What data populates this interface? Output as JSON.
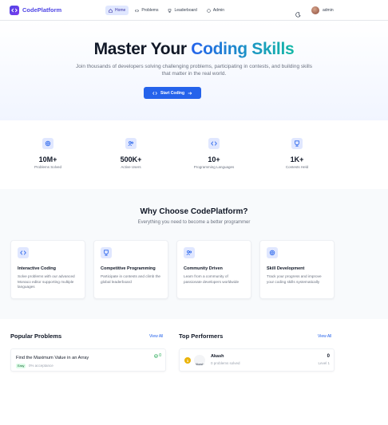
{
  "nav": {
    "brand": "CodePlatform",
    "links": [
      {
        "label": "Home",
        "icon": "home-icon",
        "active": true
      },
      {
        "label": "Problems",
        "icon": "code-icon",
        "active": false
      },
      {
        "label": "Leaderboard",
        "icon": "trophy-icon",
        "active": false
      },
      {
        "label": "Admin",
        "icon": "shield-icon",
        "active": false
      }
    ],
    "user_name": "admin"
  },
  "hero": {
    "title_plain": "Master Your ",
    "title_highlight": "Coding Skills",
    "subtitle": "Join thousands of developers solving challenging problems, participating in contests, and building skills that matter in the real world.",
    "cta_label": "Start Coding"
  },
  "stats": [
    {
      "value": "10M+",
      "label": "Problems Solved",
      "icon": "target-icon"
    },
    {
      "value": "500K+",
      "label": "Active Users",
      "icon": "users-icon"
    },
    {
      "value": "10+",
      "label": "Programming Languages",
      "icon": "code-icon"
    },
    {
      "value": "1K+",
      "label": "Contests Held",
      "icon": "trophy-icon"
    }
  ],
  "why": {
    "title": "Why Choose CodePlatform?",
    "subtitle": "Everything you need to become a better programmer",
    "features": [
      {
        "title": "Interactive Coding",
        "desc": "Solve problems with our advanced Monaco editor supporting multiple languages",
        "icon": "code-icon"
      },
      {
        "title": "Competitive Programming",
        "desc": "Participate in contests and climb the global leaderboard",
        "icon": "trophy-icon"
      },
      {
        "title": "Community Driven",
        "desc": "Learn from a community of passionate developers worldwide",
        "icon": "users-icon"
      },
      {
        "title": "Skill Development",
        "desc": "Track your progress and improve your coding skills systematically",
        "icon": "target-icon"
      }
    ]
  },
  "popular": {
    "title": "Popular Problems",
    "view_all": "View All",
    "items": [
      {
        "title": "Find the Maximum Value in an Array",
        "difficulty": "Easy",
        "acceptance": "0% acceptance",
        "count": "0"
      }
    ]
  },
  "performers": {
    "title": "Top Performers",
    "view_all": "View All",
    "items": [
      {
        "rank": "1",
        "avatar_alt": "Akash",
        "name": "Akash",
        "solved": "0 problems solved",
        "score": "0",
        "level": "Level 1"
      }
    ]
  },
  "colors": {
    "primary": "#2563eb",
    "accent": "#14b8a6",
    "brand": "#4f46e5",
    "easy_bg": "#dcfce7",
    "rank_gold": "#eab308"
  }
}
